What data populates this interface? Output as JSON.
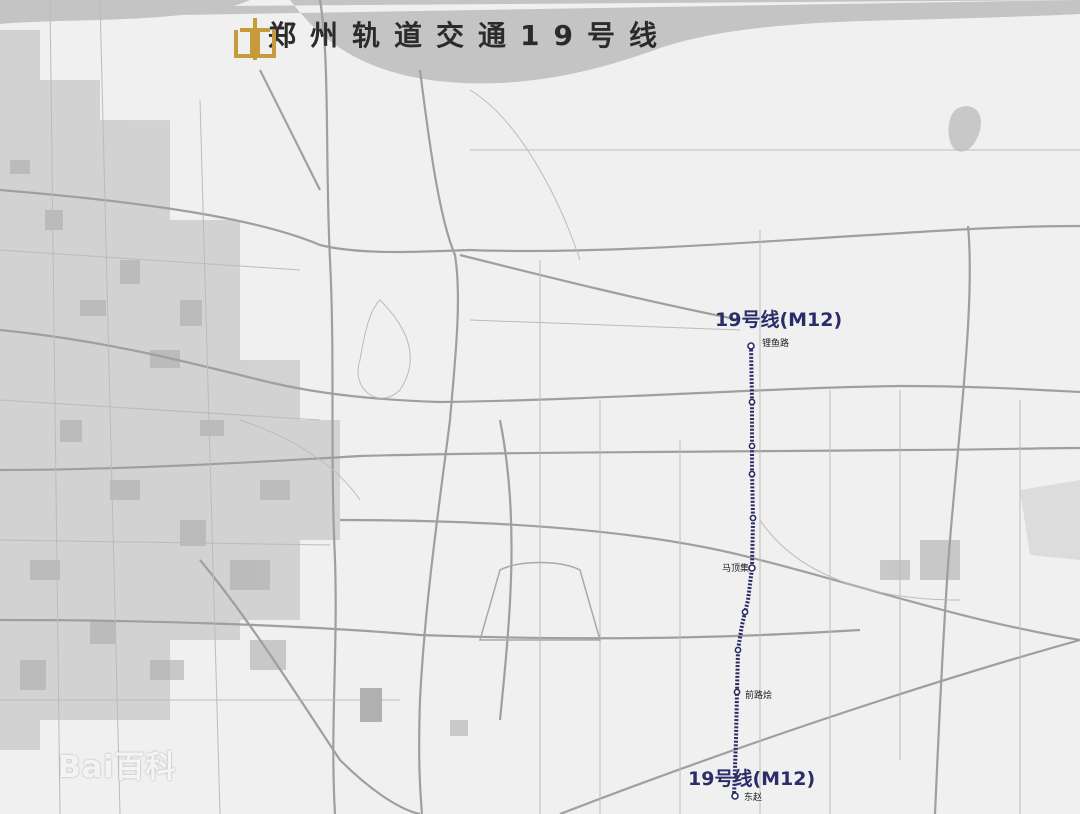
{
  "title": "郑州轨道交通19号线",
  "colors": {
    "line": "#2b2d68",
    "background": "#f0f0f0",
    "river": "#c4c4c4",
    "urban": "#bdbdbd",
    "road": "#9a9a9a",
    "logo": "#c79a3c"
  },
  "logo_icon": "zhengzhou-metro-logo-icon",
  "line_labels": {
    "top": "19号线(M12)",
    "bottom": "19号线(M12)"
  },
  "stations": {
    "north_terminal": "锂鱼路",
    "middle": "马顶集",
    "south_mid": "前路烩",
    "south_terminal": "东赵"
  },
  "watermark": "Bai百科"
}
